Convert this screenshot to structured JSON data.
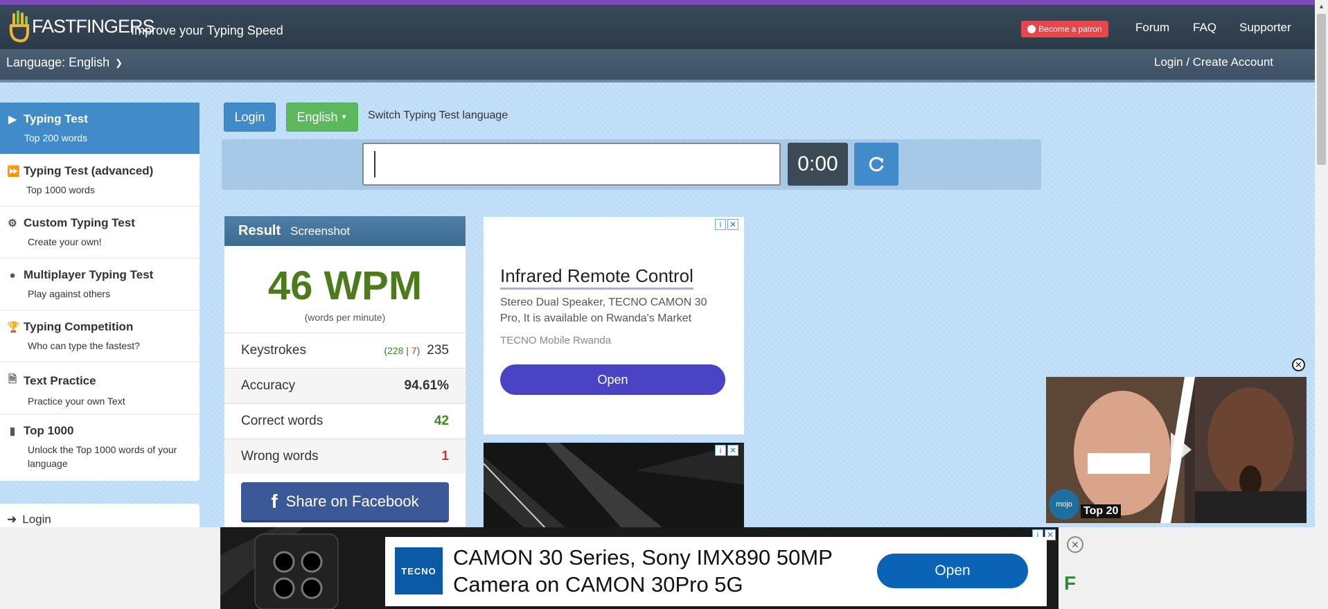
{
  "header": {
    "logo_text": "FASTFINGERS",
    "tagline": "Improve your Typing Speed",
    "patron_label": "Become a patron",
    "nav": [
      "Forum",
      "FAQ",
      "Supporter"
    ],
    "language_label": "Language: English",
    "login_create": "Login / Create Account"
  },
  "sidebar": {
    "items": [
      {
        "title": "Typing Test",
        "sub": "Top 200 words",
        "icon": "play-icon"
      },
      {
        "title": "Typing Test (advanced)",
        "sub": "Top 1000 words",
        "icon": "fast-forward-icon"
      },
      {
        "title": "Custom Typing Test",
        "sub": "Create your own!",
        "icon": "gears-icon"
      },
      {
        "title": "Multiplayer Typing Test",
        "sub": "Play against others",
        "icon": "users-icon"
      },
      {
        "title": "Typing Competition",
        "sub": "Who can type the fastest?",
        "icon": "trophy-icon"
      },
      {
        "title": "Text Practice",
        "sub": "Practice your own Text",
        "icon": "document-icon"
      },
      {
        "title": "Top 1000",
        "sub": "Unlock the Top 1000 words of your language",
        "icon": "signal-icon"
      }
    ],
    "login": "Login"
  },
  "controls": {
    "login_button": "Login",
    "language_button": "English",
    "switch_label": "Switch Typing Test language",
    "timer": "0:00"
  },
  "result": {
    "title": "Result",
    "screenshot": "Screenshot",
    "wpm": "46 WPM",
    "wpm_sub": "(words per minute)",
    "keystrokes_label": "Keystrokes",
    "keystrokes_correct": "228",
    "keystrokes_wrong": "7",
    "keystrokes_total": "235",
    "accuracy_label": "Accuracy",
    "accuracy": "94.61%",
    "correct_label": "Correct words",
    "correct": "42",
    "wrong_label": "Wrong words",
    "wrong": "1",
    "share": "Share on Facebook"
  },
  "ad1": {
    "title": "Infrared Remote Control",
    "desc": "Stereo Dual Speaker, TECNO CAMON 30 Pro, It is available on Rwanda's Market",
    "source": "TECNO Mobile Rwanda",
    "open": "Open"
  },
  "video": {
    "badge_brand": "mojo",
    "badge": "Top 20"
  },
  "bottom_ad": {
    "logo": "TECNO",
    "text": "CAMON 30 Series, Sony IMX890 50MP Camera on CAMON 30Pro 5G",
    "open": "Open"
  },
  "colors": {
    "accent_blue": "#428bca",
    "green": "#5cb85c",
    "wpm_green": "#4b7b1a",
    "purple_topbar": "#7b4bb8"
  }
}
